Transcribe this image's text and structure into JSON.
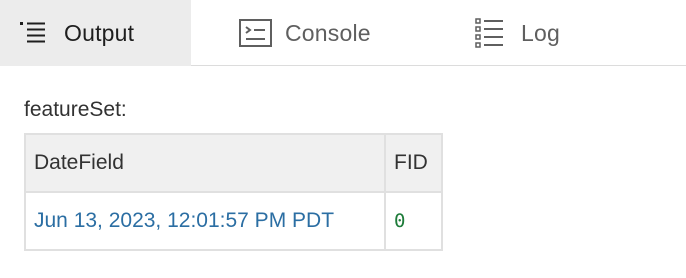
{
  "tabs": [
    {
      "label": "Output",
      "icon": "list-icon",
      "active": true
    },
    {
      "label": "Console",
      "icon": "console-icon",
      "active": false
    },
    {
      "label": "Log",
      "icon": "log-list-icon",
      "active": false
    }
  ],
  "output": {
    "label": "featureSet:",
    "table": {
      "columns": [
        "DateField",
        "FID"
      ],
      "rows": [
        [
          "Jun 13, 2023, 12:01:57 PM PDT",
          "0"
        ]
      ]
    }
  },
  "colors": {
    "date_value": "#2b6ea3",
    "number_value": "#1e7c3a",
    "active_tab_bg": "#ececec",
    "header_bg": "#f0f0f0"
  }
}
